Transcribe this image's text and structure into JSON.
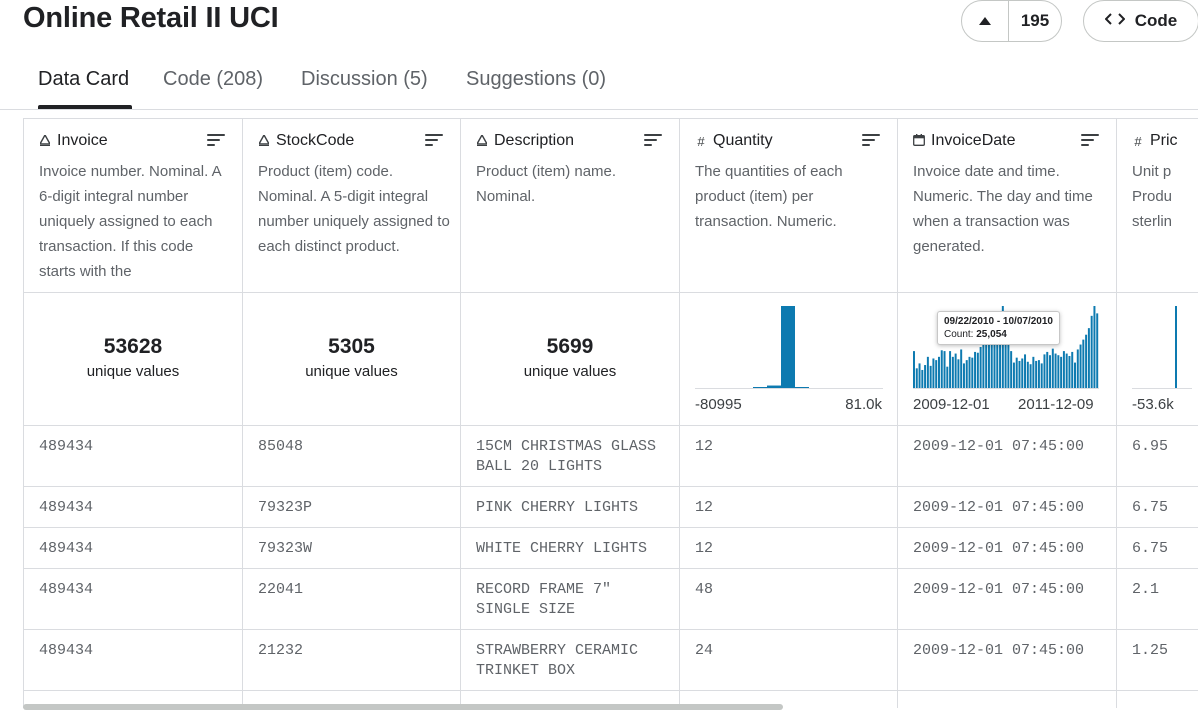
{
  "dataset_title": "Online Retail II UCI",
  "vote_count": "195",
  "code_button": "Code",
  "tabs": [
    "Data Card",
    "Code (208)",
    "Discussion (5)",
    "Suggestions (0)"
  ],
  "columns": [
    {
      "type_icon": "A",
      "name": "Invoice",
      "description": "Invoice number. Nominal. A 6-digit integral number uniquely assigned to each transaction. If this code starts with the",
      "unique_count": "53628",
      "unique_label": "unique values"
    },
    {
      "type_icon": "A",
      "name": "StockCode",
      "description": "Product (item) code. Nominal. A 5-digit integral number uniquely assigned to each distinct product.",
      "unique_count": "5305",
      "unique_label": "unique values"
    },
    {
      "type_icon": "A",
      "name": "Description",
      "description": "Product (item) name. Nominal.",
      "unique_count": "5699",
      "unique_label": "unique values"
    },
    {
      "type_icon": "#",
      "name": "Quantity",
      "description": "The quantities of each product (item) per transaction. Numeric.",
      "axis_min": "-80995",
      "axis_max": "81.0k"
    },
    {
      "type_icon": "calendar",
      "name": "InvoiceDate",
      "description": "Invoice date and time. Numeric. The day and time when a transaction was generated.",
      "axis_min": "2009-12-01",
      "axis_max": "2011-12-09",
      "tooltip_range": "09/22/2010 - 10/07/2010",
      "tooltip_count_label": "Count:",
      "tooltip_count": "25,054"
    },
    {
      "type_icon": "#",
      "name": "Pric",
      "description": "Unit p Produ sterlin",
      "axis_min": "-53.6k"
    }
  ],
  "rows": [
    [
      "489434",
      "85048",
      "15CM CHRISTMAS GLASS BALL 20 LIGHTS",
      "12",
      "2009-12-01 07:45:00",
      "6.95"
    ],
    [
      "489434",
      "79323P",
      "PINK CHERRY LIGHTS",
      "12",
      "2009-12-01 07:45:00",
      "6.75"
    ],
    [
      "489434",
      "79323W",
      "WHITE CHERRY LIGHTS",
      "12",
      "2009-12-01 07:45:00",
      "6.75"
    ],
    [
      "489434",
      "22041",
      "RECORD FRAME 7\" SINGLE SIZE",
      "48",
      "2009-12-01 07:45:00",
      "2.1"
    ],
    [
      "489434",
      "21232",
      "STRAWBERRY CERAMIC TRINKET BOX",
      "24",
      "2009-12-01 07:45:00",
      "1.25"
    ]
  ],
  "colors": {
    "bar": "#0d7ab0",
    "border": "#dadce0",
    "text_muted": "#5f6368"
  },
  "chart_data": [
    {
      "type": "bar",
      "title": "",
      "series": [
        {
          "values": [
            0.01,
            0.03,
            1.0,
            0.01
          ]
        }
      ],
      "xlim": [
        "-80995",
        "81.0k"
      ]
    },
    {
      "type": "bar",
      "title": "",
      "series": [
        {
          "values": [
            0.45,
            0.24,
            0.3,
            0.22,
            0.28,
            0.38,
            0.27,
            0.36,
            0.34,
            0.38,
            0.46,
            0.45,
            0.26,
            0.45,
            0.38,
            0.42,
            0.35,
            0.47,
            0.3,
            0.34,
            0.38,
            0.37,
            0.44,
            0.43,
            0.5,
            0.62,
            0.6,
            0.71,
            0.8,
            0.85,
            0.9,
            0.88,
            1.0,
            0.93,
            0.7,
            0.45,
            0.31,
            0.37,
            0.33,
            0.36,
            0.41,
            0.32,
            0.29,
            0.38,
            0.33,
            0.34,
            0.3,
            0.41,
            0.44,
            0.4,
            0.48,
            0.42,
            0.4,
            0.38,
            0.45,
            0.42,
            0.39,
            0.44,
            0.31,
            0.47,
            0.53,
            0.59,
            0.65,
            0.73,
            0.88,
            1.0,
            0.91
          ]
        }
      ],
      "xlim": [
        "2009-12-01",
        "2011-12-09"
      ]
    },
    {
      "type": "bar",
      "title": "",
      "series": [
        {
          "values": [
            0.0,
            1.0
          ]
        }
      ],
      "xlim": [
        "-53.6k",
        ""
      ]
    }
  ]
}
